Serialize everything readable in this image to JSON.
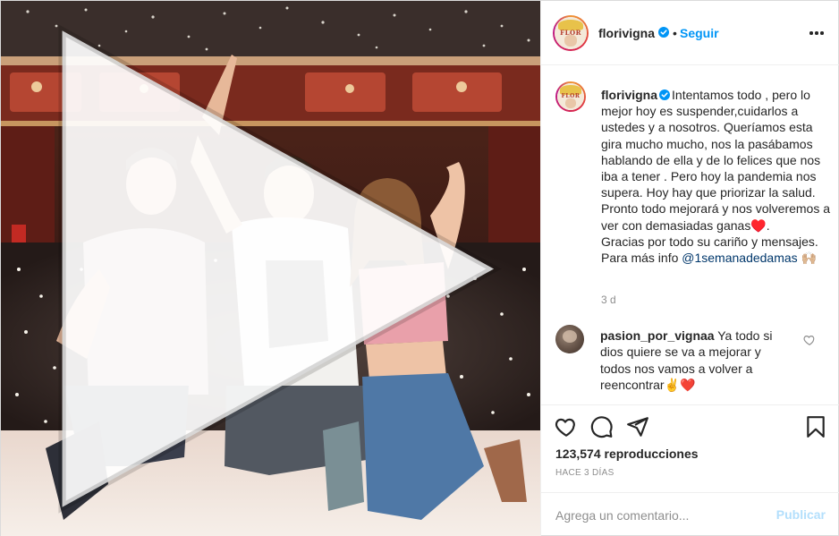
{
  "author": {
    "username": "florivigna",
    "avatar_lettering": "FLOR",
    "follow_label": "Seguir",
    "separator": "•"
  },
  "caption": {
    "username": "florivigna",
    "text": "Intentamos todo , pero lo mejor hoy es suspender,cuidarlos a ustedes y a nosotros. Queríamos esta gira mucho mucho, nos la pasábamos hablando de ella y de lo felices que nos iba a tener . Pero hoy la pandemia nos supera. Hoy hay que priorizar la salud. Pronto todo mejorará y nos volveremos a ver con demasiadas ganas♥️.\nGracias por todo su cariño y mensajes. Para más info ",
    "mention": "@1semanadedamas",
    "trailing_emoji": "🙌🏼",
    "time_ago": "3 d"
  },
  "comments": [
    {
      "username": "pasion_por_vignaa",
      "text": "Ya todo si dios quiere se va a mejorar y todos nos vamos a volver a reencontrar✌️❤️"
    }
  ],
  "stats": {
    "views": "123,574 reproducciones",
    "date": "HACE 3 DÍAS"
  },
  "comment_box": {
    "placeholder": "Agrega un comentario...",
    "post_label": "Publicar"
  },
  "icons": {
    "verified": "verified-badge-icon",
    "more": "more-options-icon",
    "like": "heart-icon",
    "comment": "comment-icon",
    "share": "paper-plane-icon",
    "save": "bookmark-icon",
    "play": "play-icon"
  },
  "colors": {
    "link_blue": "#0095f6",
    "post_disabled": "#b3dffc",
    "secondary_text": "#8e8e8e",
    "mention": "#00376b",
    "heart_red": "#ed4956"
  }
}
